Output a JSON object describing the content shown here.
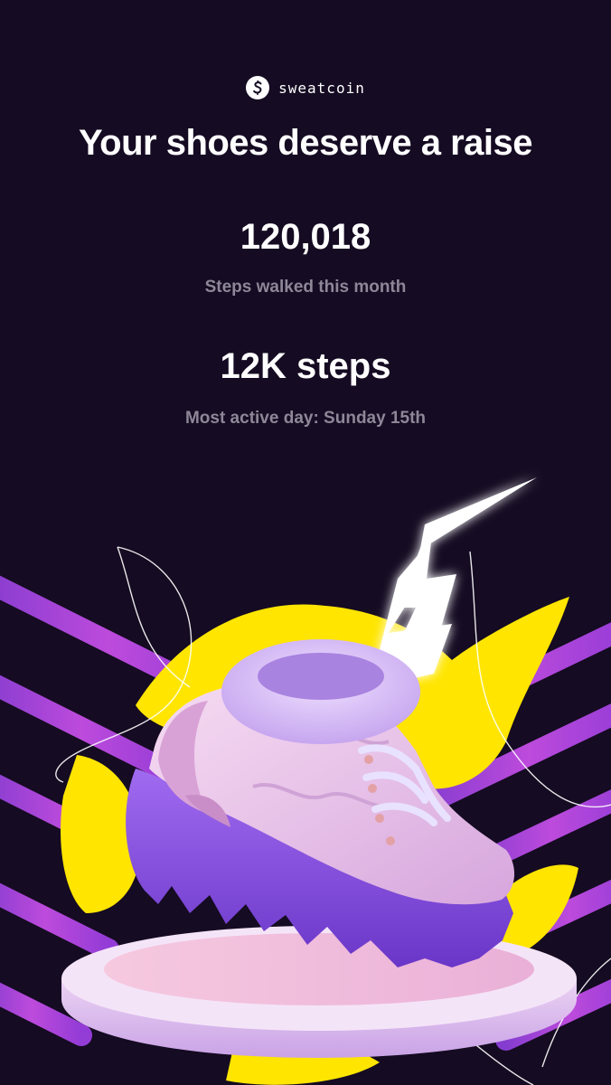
{
  "brand": {
    "name": "sweatcoin",
    "logo_icon": "sweatcoin-logo-icon"
  },
  "headline": "Your shoes deserve a raise",
  "stats": [
    {
      "value": "120,018",
      "label": "Steps walked this month"
    },
    {
      "value": "12K steps",
      "label": "Most active day: Sunday 15th"
    }
  ],
  "colors": {
    "background": "#150b22",
    "accent_yellow": "#ffe500",
    "stripe_purple": "#b144e0",
    "shoe_sole": "#8a4fe6",
    "shoe_upper": "#e8c6ea",
    "platform": "#f2b9dc",
    "label_gray": "#8e8798"
  },
  "illustration": {
    "icon": "sneaker-on-pedestal-icon",
    "bolt_icon": "lightning-bolt-icon"
  }
}
